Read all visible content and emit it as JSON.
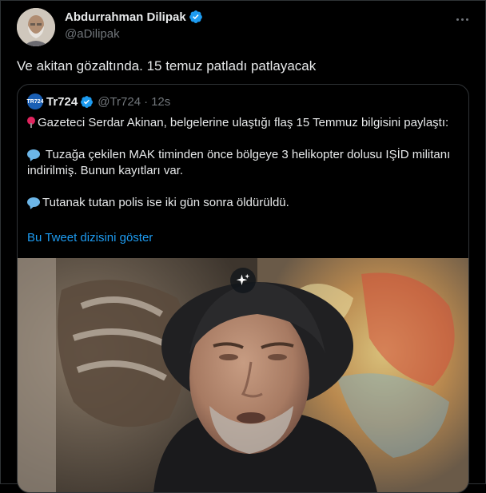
{
  "author": {
    "name": "Abdurrahman Dilipak",
    "handle": "@aDilipak"
  },
  "tweet": {
    "text": "Ve akitan gözaltında. 15 temuz patladı patlayacak"
  },
  "quoted": {
    "avatar_text": "TR724",
    "name": "Tr724",
    "handle": "@Tr724",
    "dot": "·",
    "time": "12s",
    "paragraphs": [
      "Gazeteci Serdar Akinan, belgelerine ulaştığı flaş 15 Temmuz bilgisini paylaştı:",
      "Tuzağa çekilen MAK timinden önce bölgeye 3 helikopter dolusu IŞİD militanı indirilmiş. Bunun kayıtları var.",
      "Tutanak tutan polis ise iki gün sonra öldürüldü."
    ],
    "show_thread": "Bu Tweet dizisini göster"
  },
  "icons": {
    "verified": "verified-badge-icon",
    "more": "more-icon",
    "pin": "round-pushpin-icon",
    "speech": "speech-balloon-icon",
    "sparkle": "sparkle-icon"
  },
  "colors": {
    "background": "#000000",
    "text": "#e7e9ea",
    "secondary": "#71767b",
    "link": "#1d9bf0",
    "verified": "#1d9bf0",
    "border": "#2f3336"
  }
}
